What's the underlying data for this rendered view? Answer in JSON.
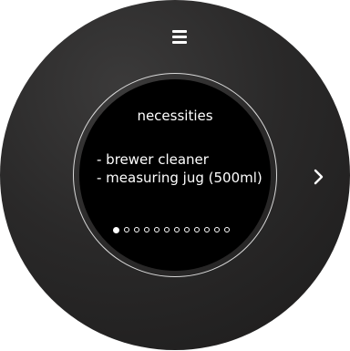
{
  "screen": {
    "title": "necessities",
    "items": [
      "- brewer cleaner",
      "- measuring jug (500ml)"
    ]
  },
  "pagination": {
    "total_pages": 12,
    "current_page": 1
  },
  "icons": {
    "menu": "hamburger-menu-icon",
    "next": "chevron-right-icon"
  },
  "colors": {
    "bezel": "#2a2929",
    "screen": "#000000",
    "text": "#ffffff",
    "ring": "#d9d9d9"
  }
}
